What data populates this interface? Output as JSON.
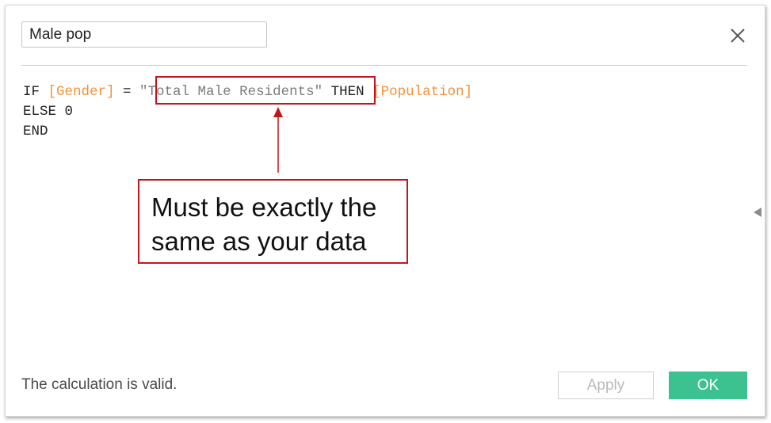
{
  "dialog": {
    "calc_name": "Male pop",
    "close_icon": "close-icon"
  },
  "code": {
    "line1": {
      "if": "IF ",
      "field1": "[Gender]",
      "eq": " = ",
      "string": "\"Total Male Residents\"",
      "then": " THEN ",
      "field2": "[Population]"
    },
    "line2": "ELSE 0",
    "line3": "END"
  },
  "annotation": {
    "callout_line1": "Must be exactly the",
    "callout_line2": "same as your data",
    "color": "#c0161e"
  },
  "footer": {
    "status": "The calculation is valid.",
    "apply_label": "Apply",
    "ok_label": "OK",
    "ok_color": "#3cc190"
  },
  "colors": {
    "field": "#f0923c",
    "string": "#7b7b7b"
  }
}
